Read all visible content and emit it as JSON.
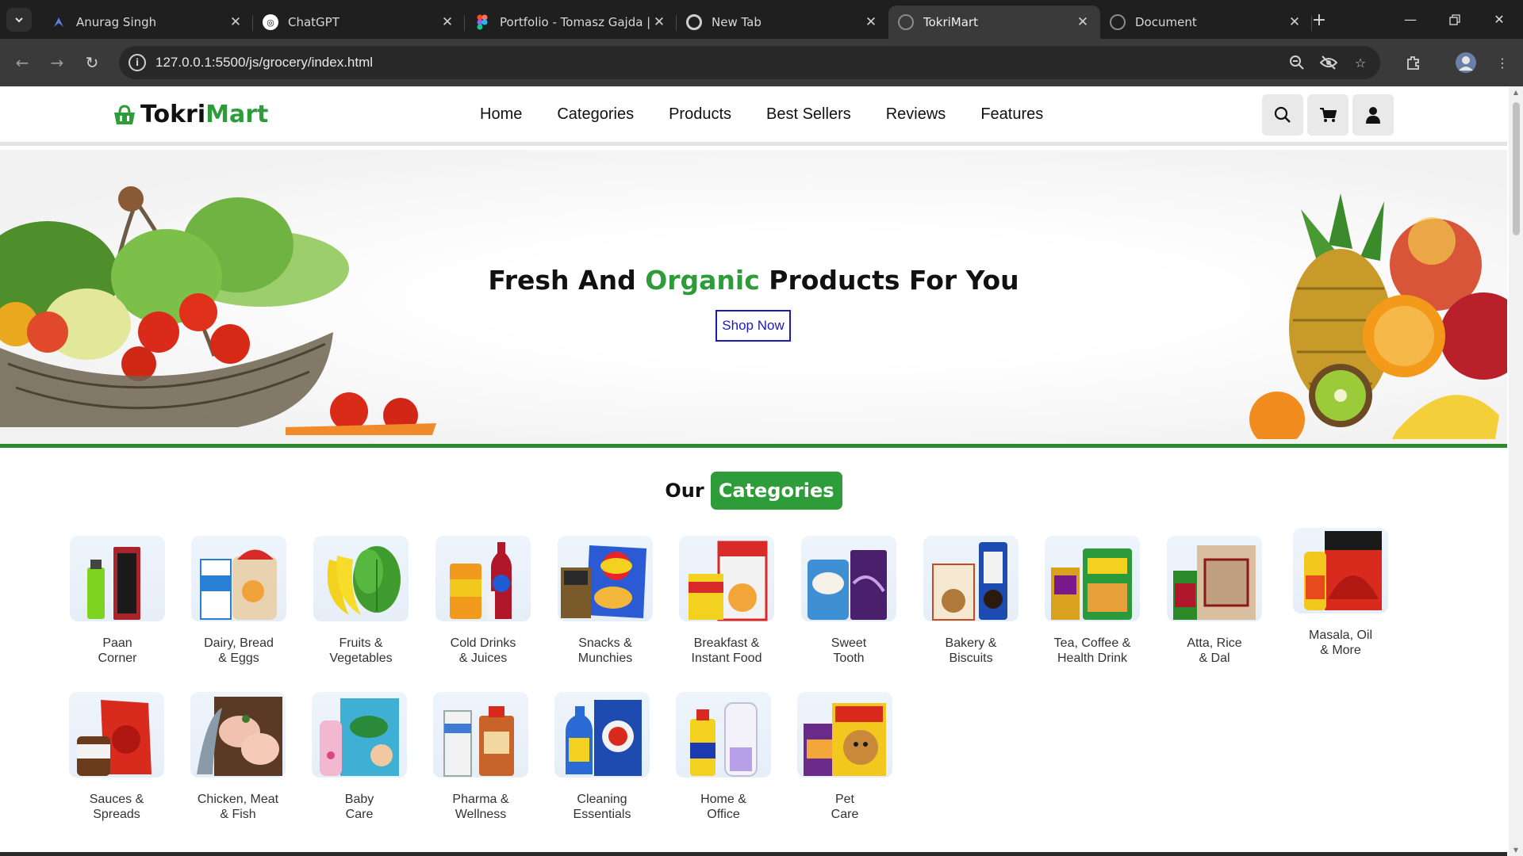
{
  "browser": {
    "tabs": [
      {
        "title": "Anurag Singh",
        "active": false
      },
      {
        "title": "ChatGPT",
        "active": false
      },
      {
        "title": "Portfolio - Tomasz Gajda | I",
        "active": false
      },
      {
        "title": "New Tab",
        "active": false
      },
      {
        "title": "TokriMart",
        "active": true
      },
      {
        "title": "Document",
        "active": false
      }
    ],
    "url": "127.0.0.1:5500/js/grocery/index.html",
    "icons": {
      "tab_menu": "chevron-down-icon",
      "new_tab": "plus-icon",
      "minimize": "minimize-icon",
      "restore": "restore-icon",
      "close": "close-icon",
      "back": "arrow-left-icon",
      "forward": "arrow-right-icon",
      "reload": "reload-icon",
      "site_info": "info-icon",
      "zoom": "zoom-out-icon",
      "eye": "eye-off-icon",
      "bookmark": "star-icon",
      "extensions": "puzzle-icon",
      "profile": "avatar-icon",
      "menu": "kebab-menu-icon"
    }
  },
  "site": {
    "logo": {
      "part1": "Tokri",
      "part2": "Mart",
      "icon": "shopping-basket-icon"
    },
    "nav": [
      "Home",
      "Categories",
      "Products",
      "Best Sellers",
      "Reviews",
      "Features"
    ],
    "header_buttons": [
      "search-icon",
      "cart-icon",
      "user-icon"
    ]
  },
  "hero": {
    "title_before": "Fresh And ",
    "title_highlight": "Organic",
    "title_after": " Products For You",
    "button": "Shop Now"
  },
  "categories": {
    "title_plain": "Our",
    "title_highlight": "Categories",
    "items": [
      "Paan\nCorner",
      "Dairy, Bread\n& Eggs",
      "Fruits &\nVegetables",
      "Cold Drinks\n& Juices",
      "Snacks &\nMunchies",
      "Breakfast &\nInstant Food",
      "Sweet\nTooth",
      "Bakery &\nBiscuits",
      "Tea, Coffee &\nHealth Drink",
      "Atta, Rice\n& Dal",
      "Masala, Oil\n& More",
      "Sauces &\nSpreads",
      "Chicken, Meat\n& Fish",
      "Baby\nCare",
      "Pharma &\nWellness",
      "Cleaning\nEssentials",
      "Home &\nOffice",
      "Pet\nCare"
    ]
  },
  "colors": {
    "brand_green": "#2e9c39",
    "shop_blue": "#1e1ab4",
    "chrome_dark": "#1f1f1f"
  }
}
